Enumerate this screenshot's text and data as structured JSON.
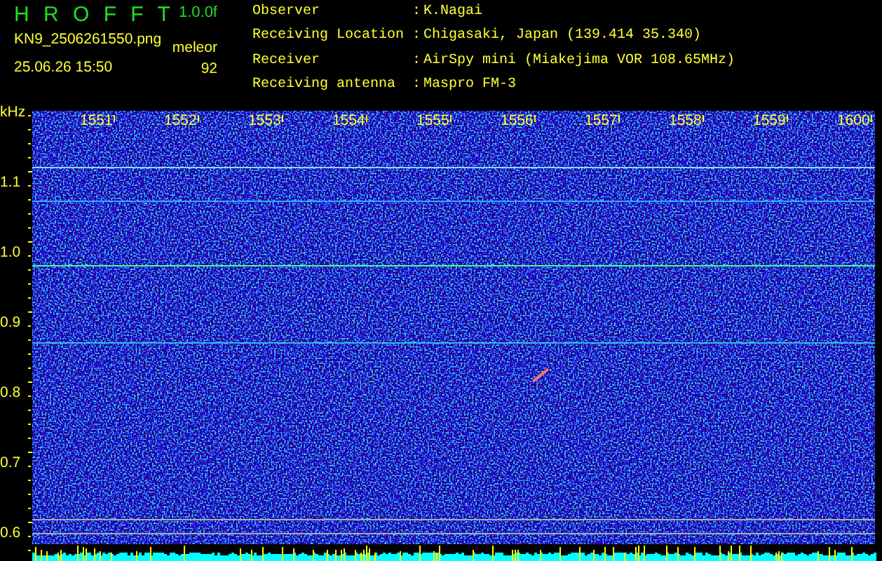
{
  "header": {
    "title": "H R O F F T",
    "version": "1.0.0f",
    "file_name": "KN9_2506261550.png",
    "timestamp": "25.06.26 15:50",
    "detection_label": "meleor",
    "detection_count": "92"
  },
  "station_info": [
    {
      "label": "Observer",
      "separator": ":",
      "value": "K.Nagai"
    },
    {
      "label": "Receiving Location",
      "separator": ":",
      "value": "Chigasaki, Japan (139.414 35.340)"
    },
    {
      "label": "Receiver",
      "separator": ":",
      "value": "AirSpy mini (Miakejima VOR 108.65MHz)"
    },
    {
      "label": "Receiving antenna",
      "separator": ":",
      "value": "Maspro FM-3"
    }
  ],
  "spectrogram": {
    "y_unit": "kHz",
    "y_labels": [
      "1.1",
      "1.0",
      "0.9",
      "0.8",
      "0.7",
      "0.6"
    ],
    "x_labels": [
      "1551",
      "1552",
      "1553",
      "1554",
      "1555",
      "1556",
      "1557",
      "1558",
      "1559",
      "1600"
    ]
  }
}
